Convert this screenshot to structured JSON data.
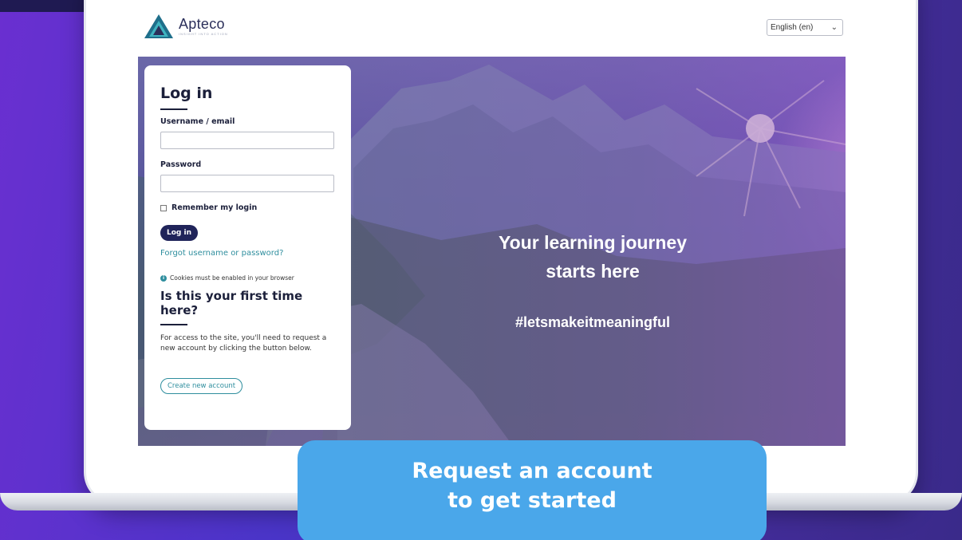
{
  "brand": {
    "name": "Apteco",
    "tagline": "INSIGHT INTO ACTION",
    "accent": "#2f8e9e",
    "navy": "#20245a"
  },
  "language": {
    "selected": "English (en)"
  },
  "hero": {
    "title_line1": "Your learning journey",
    "title_line2": "starts here",
    "hashtag": "#letsmakeitmeaningful"
  },
  "login": {
    "title": "Log in",
    "username_label": "Username / email",
    "username_value": "",
    "password_label": "Password",
    "password_value": "",
    "remember_label": "Remember my login",
    "login_button": "Log in",
    "forgot_link": "Forgot username or password?",
    "cookies_notice": "Cookies must be enabled in your browser",
    "first_time_title": "Is this your first time here?",
    "first_time_text": "For access to the site, you'll need to request a new account by clicking the button below.",
    "create_button": "Create new account"
  },
  "cta": {
    "line1": "Request an account",
    "line2": "to get started",
    "color": "#4aa7ea"
  }
}
